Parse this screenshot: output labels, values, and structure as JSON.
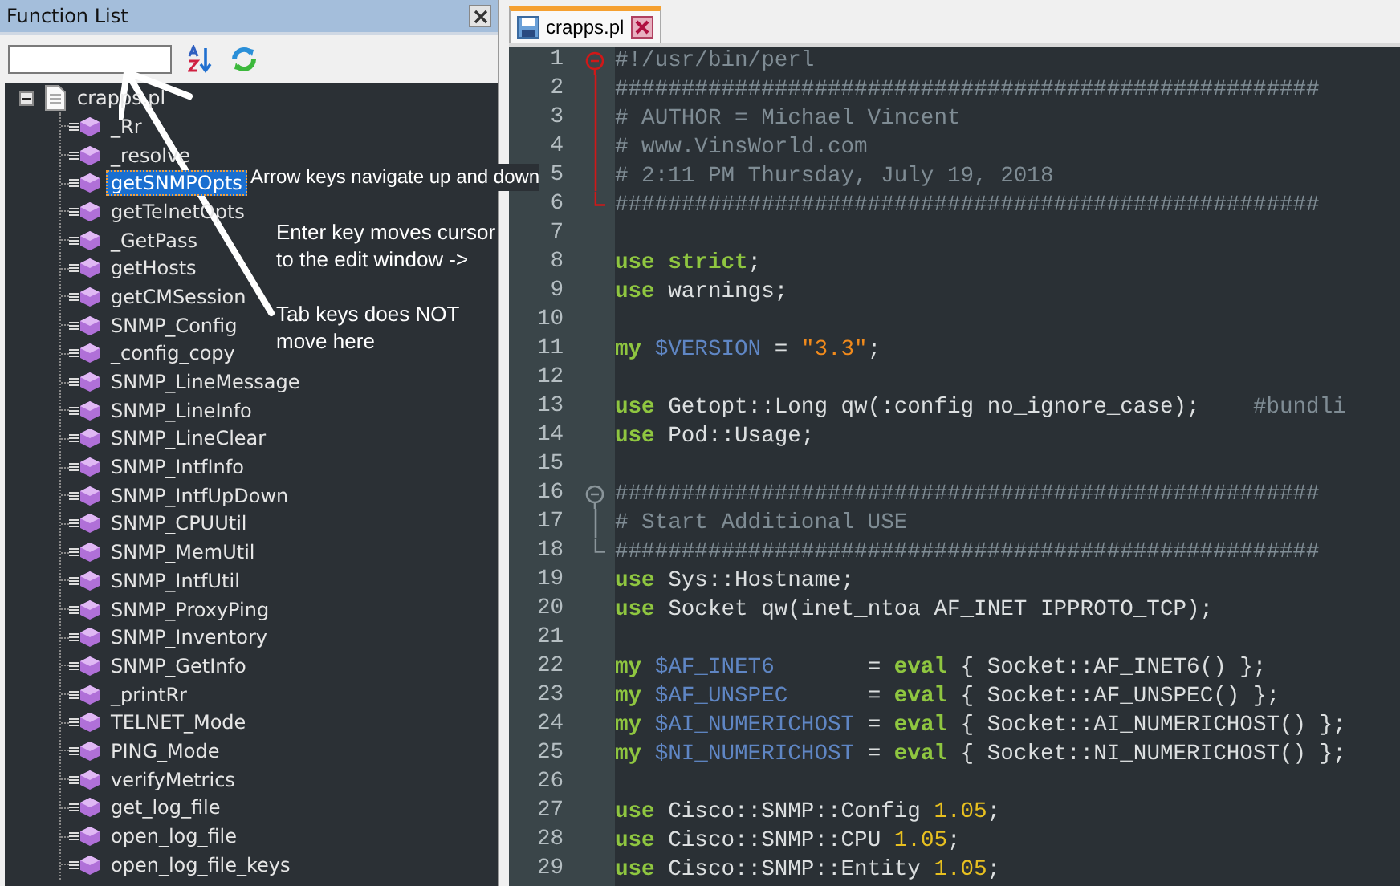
{
  "function_list": {
    "title": "Function List",
    "tree": {
      "label": "crapps.pl",
      "expanded": true,
      "children": [
        {
          "label": "_Rr",
          "selected": false
        },
        {
          "label": "_resolve",
          "selected": false
        },
        {
          "label": "getSNMPOpts",
          "selected": true
        },
        {
          "label": "getTelnetOpts",
          "selected": false
        },
        {
          "label": "_GetPass",
          "selected": false
        },
        {
          "label": "getHosts",
          "selected": false
        },
        {
          "label": "getCMSession",
          "selected": false
        },
        {
          "label": "SNMP_Config",
          "selected": false
        },
        {
          "label": "_config_copy",
          "selected": false
        },
        {
          "label": "SNMP_LineMessage",
          "selected": false
        },
        {
          "label": "SNMP_LineInfo",
          "selected": false
        },
        {
          "label": "SNMP_LineClear",
          "selected": false
        },
        {
          "label": "SNMP_IntfInfo",
          "selected": false
        },
        {
          "label": "SNMP_IntfUpDown",
          "selected": false
        },
        {
          "label": "SNMP_CPUUtil",
          "selected": false
        },
        {
          "label": "SNMP_MemUtil",
          "selected": false
        },
        {
          "label": "SNMP_IntfUtil",
          "selected": false
        },
        {
          "label": "SNMP_ProxyPing",
          "selected": false
        },
        {
          "label": "SNMP_Inventory",
          "selected": false
        },
        {
          "label": "SNMP_GetInfo",
          "selected": false
        },
        {
          "label": "_printRr",
          "selected": false
        },
        {
          "label": "TELNET_Mode",
          "selected": false
        },
        {
          "label": "PING_Mode",
          "selected": false
        },
        {
          "label": "verifyMetrics",
          "selected": false
        },
        {
          "label": "get_log_file",
          "selected": false
        },
        {
          "label": "open_log_file",
          "selected": false
        },
        {
          "label": "open_log_file_keys",
          "selected": false
        }
      ]
    }
  },
  "editor": {
    "tabs": [
      {
        "label": "crapps.pl",
        "selected": true
      }
    ],
    "lines": [
      {
        "number": "1",
        "fold": {
          "kind": "start",
          "active": true
        },
        "tokens": [
          {
            "kind": "comment",
            "text": "#!/usr/bin/perl"
          }
        ]
      },
      {
        "number": "2",
        "fold": {
          "kind": "body",
          "active": true
        },
        "tokens": [
          {
            "kind": "comment",
            "text": "#####################################################"
          }
        ]
      },
      {
        "number": "3",
        "fold": {
          "kind": "body",
          "active": true
        },
        "tokens": [
          {
            "kind": "comment",
            "text": "# AUTHOR = Michael Vincent"
          }
        ]
      },
      {
        "number": "4",
        "fold": {
          "kind": "body",
          "active": true
        },
        "tokens": [
          {
            "kind": "comment",
            "text": "# www.VinsWorld.com"
          }
        ]
      },
      {
        "number": "5",
        "fold": {
          "kind": "body",
          "active": true
        },
        "tokens": [
          {
            "kind": "comment",
            "text": "# 2:11 PM Thursday, July 19, 2018"
          }
        ]
      },
      {
        "number": "6",
        "fold": {
          "kind": "end",
          "active": true
        },
        "tokens": [
          {
            "kind": "comment",
            "text": "#####################################################"
          }
        ]
      },
      {
        "number": "7"
      },
      {
        "number": "8",
        "tokens": [
          {
            "kind": "keyword",
            "text": "use strict"
          },
          {
            "kind": "plain",
            "text": ";"
          }
        ]
      },
      {
        "number": "9",
        "tokens": [
          {
            "kind": "keyword",
            "text": "use "
          },
          {
            "kind": "plain",
            "text": "warnings;"
          }
        ]
      },
      {
        "number": "10"
      },
      {
        "number": "11",
        "tokens": [
          {
            "kind": "keyword",
            "text": "my "
          },
          {
            "kind": "variable",
            "text": "$VERSION"
          },
          {
            "kind": "plain",
            "text": " = "
          },
          {
            "kind": "string",
            "text": "\"3.3\""
          },
          {
            "kind": "plain",
            "text": ";"
          }
        ]
      },
      {
        "number": "12"
      },
      {
        "number": "13",
        "tokens": [
          {
            "kind": "keyword",
            "text": "use "
          },
          {
            "kind": "plain",
            "text": "Getopt::Long qw(:config no_ignore_case);    "
          },
          {
            "kind": "comment",
            "text": "#bundli"
          }
        ]
      },
      {
        "number": "14",
        "tokens": [
          {
            "kind": "keyword",
            "text": "use "
          },
          {
            "kind": "plain",
            "text": "Pod::Usage;"
          }
        ]
      },
      {
        "number": "15"
      },
      {
        "number": "16",
        "fold": {
          "kind": "start",
          "active": false
        },
        "tokens": [
          {
            "kind": "comment",
            "text": "#####################################################"
          }
        ]
      },
      {
        "number": "17",
        "fold": {
          "kind": "body",
          "active": false
        },
        "tokens": [
          {
            "kind": "comment",
            "text": "# Start Additional USE"
          }
        ]
      },
      {
        "number": "18",
        "fold": {
          "kind": "end",
          "active": false
        },
        "tokens": [
          {
            "kind": "comment",
            "text": "#####################################################"
          }
        ]
      },
      {
        "number": "19",
        "tokens": [
          {
            "kind": "keyword",
            "text": "use "
          },
          {
            "kind": "plain",
            "text": "Sys::Hostname;"
          }
        ]
      },
      {
        "number": "20",
        "tokens": [
          {
            "kind": "keyword",
            "text": "use "
          },
          {
            "kind": "plain",
            "text": "Socket qw(inet_ntoa AF_INET IPPROTO_TCP);"
          }
        ]
      },
      {
        "number": "21"
      },
      {
        "number": "22",
        "tokens": [
          {
            "kind": "keyword",
            "text": "my "
          },
          {
            "kind": "variable",
            "text": "$AF_INET6"
          },
          {
            "kind": "plain",
            "text": "       = "
          },
          {
            "kind": "keyword",
            "text": "eval"
          },
          {
            "kind": "plain",
            "text": " { Socket::AF_INET6() };"
          }
        ]
      },
      {
        "number": "23",
        "tokens": [
          {
            "kind": "keyword",
            "text": "my "
          },
          {
            "kind": "variable",
            "text": "$AF_UNSPEC"
          },
          {
            "kind": "plain",
            "text": "      = "
          },
          {
            "kind": "keyword",
            "text": "eval"
          },
          {
            "kind": "plain",
            "text": " { Socket::AF_UNSPEC() };"
          }
        ]
      },
      {
        "number": "24",
        "tokens": [
          {
            "kind": "keyword",
            "text": "my "
          },
          {
            "kind": "variable",
            "text": "$AI_NUMERICHOST"
          },
          {
            "kind": "plain",
            "text": " = "
          },
          {
            "kind": "keyword",
            "text": "eval"
          },
          {
            "kind": "plain",
            "text": " { Socket::AI_NUMERICHOST() };"
          }
        ]
      },
      {
        "number": "25",
        "tokens": [
          {
            "kind": "keyword",
            "text": "my "
          },
          {
            "kind": "variable",
            "text": "$NI_NUMERICHOST"
          },
          {
            "kind": "plain",
            "text": " = "
          },
          {
            "kind": "keyword",
            "text": "eval"
          },
          {
            "kind": "plain",
            "text": " { Socket::NI_NUMERICHOST() };"
          }
        ]
      },
      {
        "number": "26"
      },
      {
        "number": "27",
        "tokens": [
          {
            "kind": "keyword",
            "text": "use "
          },
          {
            "kind": "plain",
            "text": "Cisco::SNMP::Config "
          },
          {
            "kind": "number",
            "text": "1.05"
          },
          {
            "kind": "plain",
            "text": ";"
          }
        ]
      },
      {
        "number": "28",
        "tokens": [
          {
            "kind": "keyword",
            "text": "use "
          },
          {
            "kind": "plain",
            "text": "Cisco::SNMP::CPU "
          },
          {
            "kind": "number",
            "text": "1.05"
          },
          {
            "kind": "plain",
            "text": ";"
          }
        ]
      },
      {
        "number": "29",
        "tokens": [
          {
            "kind": "keyword",
            "text": "use "
          },
          {
            "kind": "plain",
            "text": "Cisco::SNMP::Entity "
          },
          {
            "kind": "number",
            "text": "1.05"
          },
          {
            "kind": "plain",
            "text": ";"
          }
        ]
      }
    ]
  },
  "annotations": [
    {
      "lines": [
        "Arrow keys navigate up and down"
      ]
    },
    {
      "lines": [
        "Enter key moves cursor",
        "to the edit window ->"
      ]
    },
    {
      "lines": [
        "Tab keys does NOT",
        "move here"
      ]
    }
  ]
}
